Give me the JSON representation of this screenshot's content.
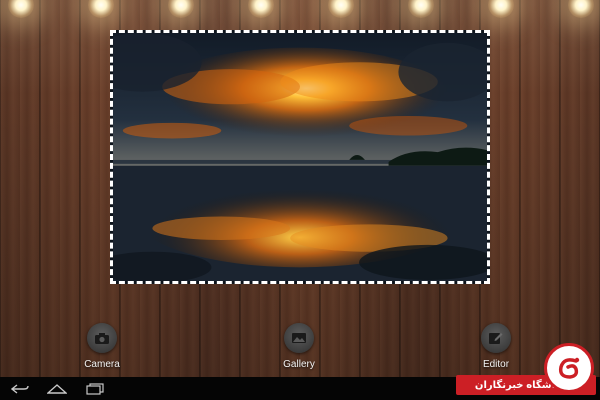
{
  "actions": {
    "camera": {
      "label": "Camera",
      "icon": "camera-icon"
    },
    "gallery": {
      "label": "Gallery",
      "icon": "gallery-icon"
    },
    "editor": {
      "label": "Editor",
      "icon": "edit-icon"
    }
  },
  "navbar": {
    "back": "back-icon",
    "home": "home-icon",
    "recents": "recents-icon"
  },
  "watermark": {
    "text": "باشگاه خبرنگاران"
  },
  "colors": {
    "wood": "#5f3827",
    "frame_border": "#ffffff",
    "navbar": "#050505",
    "watermark_red": "#cc1f25"
  }
}
